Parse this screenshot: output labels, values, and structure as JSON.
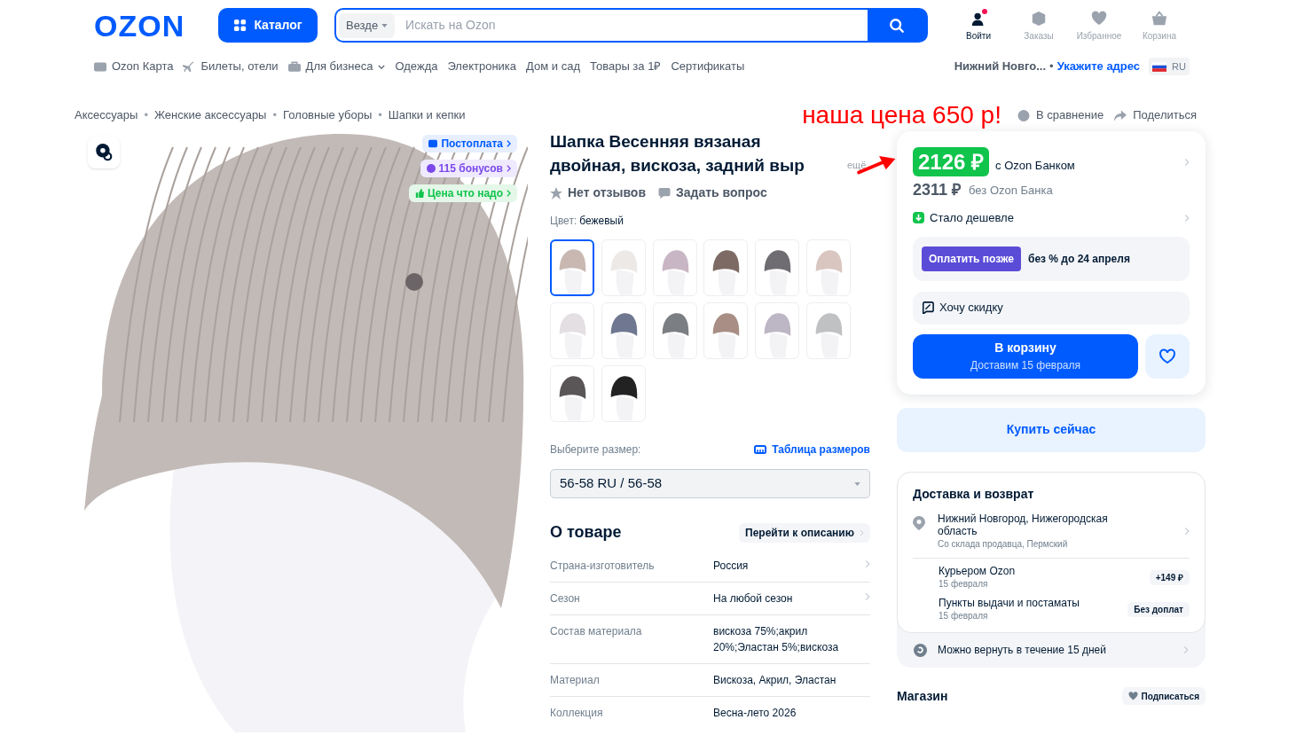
{
  "header": {
    "logo": "OZON",
    "catalog_button": "Каталог",
    "search": {
      "scope": "Везде",
      "placeholder": "Искать на Ozon"
    },
    "actions": [
      {
        "kind": "user",
        "label": "Войти",
        "notification": true
      },
      {
        "kind": "orders",
        "label": "Заказы",
        "notification": false
      },
      {
        "kind": "favorites",
        "label": "Избранное",
        "notification": false
      },
      {
        "kind": "cart",
        "label": "Корзина",
        "notification": false
      }
    ]
  },
  "nav": [
    {
      "kind": "card",
      "label": "Ozon Карта"
    },
    {
      "kind": "plane",
      "label": "Билеты, отели"
    },
    {
      "kind": "business",
      "label": "Для бизнеса"
    },
    {
      "kind": "plain",
      "label": "Одежда"
    },
    {
      "kind": "plain",
      "label": "Электроника"
    },
    {
      "kind": "plain",
      "label": "Дом и сад"
    },
    {
      "kind": "plain",
      "label": "Товары за 1₽"
    },
    {
      "kind": "plain",
      "label": "Сертификаты"
    }
  ],
  "location": {
    "city": "Нижний Новго...",
    "separator": "•",
    "link": "Укажите адрес",
    "lang": "RU"
  },
  "breadcrumbs": [
    "Аксессуары",
    "Женские аксессуары",
    "Головные уборы",
    "Шапки и кепки"
  ],
  "breadcrumb_separator": "•",
  "annotation": "наша цена 650 р!",
  "top_actions": [
    {
      "kind": "compare",
      "label": "В сравнение"
    },
    {
      "kind": "share",
      "label": "Поделиться"
    }
  ],
  "image_badges": [
    {
      "kind": "postpay",
      "label": "Постоплата"
    },
    {
      "kind": "bonus",
      "label": "115 бонусов"
    },
    {
      "kind": "good_price",
      "label": "Цена что надо"
    }
  ],
  "product": {
    "title": "Шапка Весенняя вязаная двойная, вискоза, задний выр",
    "more": "ещё",
    "reviews": "Нет отзывов",
    "ask": "Задать вопрос",
    "color_label": "Цвет:",
    "color_value": "бежевый",
    "swatches": [
      {
        "color": "#c9b8b2",
        "selected": true
      },
      {
        "color": "#ece9e6",
        "selected": false
      },
      {
        "color": "#c9b6c4",
        "selected": false
      },
      {
        "color": "#7d6a64",
        "selected": false
      },
      {
        "color": "#6f6c72",
        "selected": false
      },
      {
        "color": "#d9c6c0",
        "selected": false
      },
      {
        "color": "#e4dfe2",
        "selected": false
      },
      {
        "color": "#6f7890",
        "selected": false
      },
      {
        "color": "#7b7e82",
        "selected": false
      },
      {
        "color": "#a88e84",
        "selected": false
      },
      {
        "color": "#bdb6c4",
        "selected": false
      },
      {
        "color": "#bfc1c3",
        "selected": false
      },
      {
        "color": "#5a5557",
        "selected": false
      },
      {
        "color": "#222222",
        "selected": false
      }
    ],
    "size_label": "Выберите размер:",
    "size_table": "Таблица размеров",
    "size_value": "56-58 RU / 56-58",
    "about_title": "О товаре",
    "about_link": "Перейти к описанию",
    "specs": [
      {
        "name": "Страна-изготовитель",
        "value": "Россия",
        "link": true
      },
      {
        "name": "Сезон",
        "value": "На любой сезон",
        "link": true
      },
      {
        "name": "Состав материала",
        "value": "вискоза 75%;акрил 20%;Эластан 5%;вискоза",
        "link": false
      },
      {
        "name": "Материал",
        "value": "Вискоза, Акрил, Эластан",
        "link": false
      },
      {
        "name": "Коллекция",
        "value": "Весна-лето 2026",
        "link": false
      }
    ]
  },
  "price": {
    "card_price": "2126 ₽",
    "card_label": "с Ozon Банком",
    "price": "2311 ₽",
    "price_label": "без Ozon Банка",
    "cheaper": "Стало дешевле",
    "pay_later": "Оплатить позже",
    "pay_later_text": "без % до 24 апреля",
    "discount": "Хочу скидку",
    "cart_button": "В корзину",
    "cart_sub": "Доставим 15 февраля",
    "buy_now": "Купить сейчас"
  },
  "delivery": {
    "title": "Доставка и возврат",
    "address": "Нижний Новгород, Нижегородская область",
    "address_sub": "Со склада продавца, Пермский",
    "options": [
      {
        "name": "Курьером Ozon",
        "date": "15 февраля",
        "badge": "+149 ₽"
      },
      {
        "name": "Пункты выдачи и постаматы",
        "date": "15 февраля",
        "badge": "Без доплат"
      }
    ],
    "return": "Можно вернуть в течение 15 дней"
  },
  "shop": {
    "title": "Магазин",
    "subscribe": "Подписаться"
  }
}
